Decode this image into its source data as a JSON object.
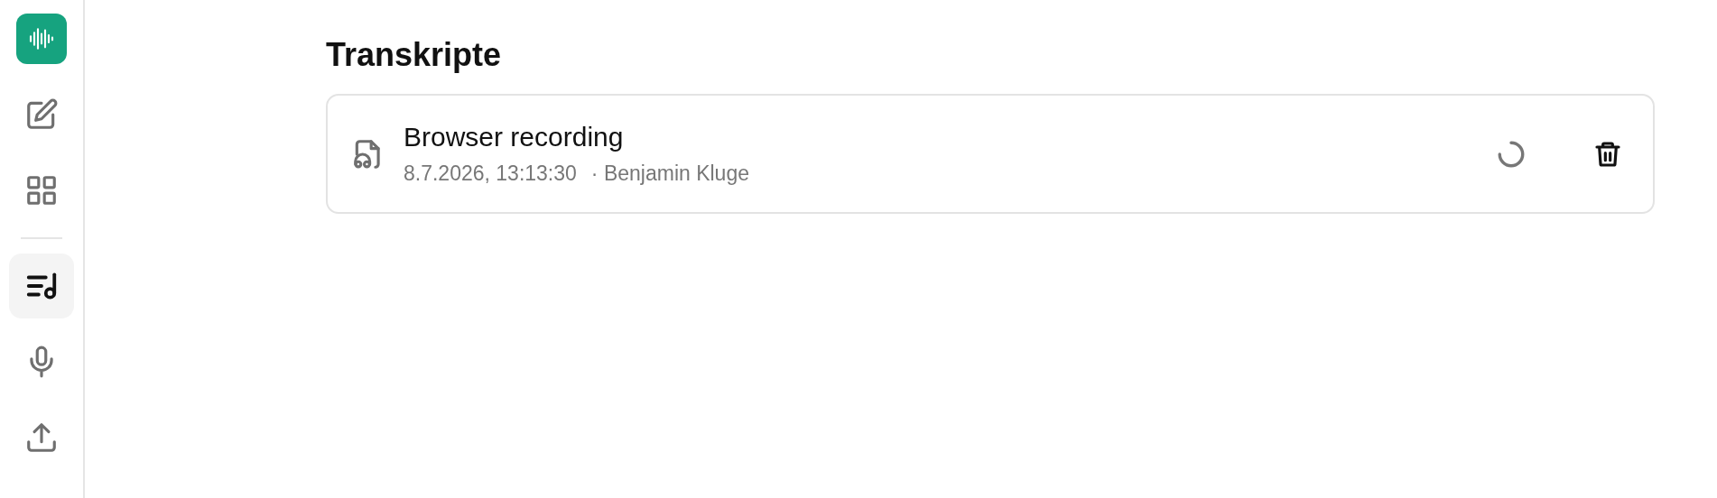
{
  "sidebar": {
    "items": [
      {
        "kind": "edit",
        "selected": false
      },
      {
        "kind": "grid",
        "selected": false
      },
      {
        "kind": "divider"
      },
      {
        "kind": "transcripts",
        "selected": true
      },
      {
        "kind": "mic",
        "selected": false
      },
      {
        "kind": "upload",
        "selected": false
      }
    ]
  },
  "page": {
    "title": "Transkripte"
  },
  "transcripts": [
    {
      "title": "Browser recording",
      "date": "8.7.2026, 13:13:30",
      "author": "· Benjamin Kluge",
      "processing": true
    }
  ]
}
